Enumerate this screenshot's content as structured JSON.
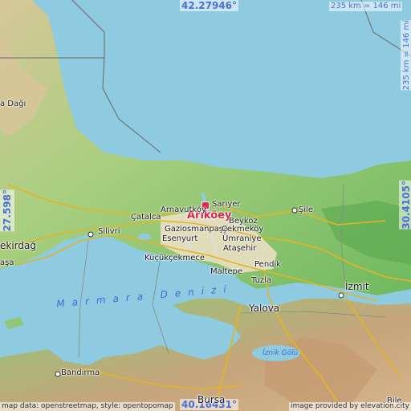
{
  "map": {
    "target": "Arıköey",
    "target_color": "#e0284f",
    "sea_color": "#8ecbe0",
    "land_colors": [
      "#7ec26b",
      "#b9d58a",
      "#d8c89b",
      "#c9a47a"
    ],
    "lat_top": "42.27946°",
    "lat_bottom": "40.16431°",
    "lon_left": "27.598°",
    "lon_right": "30.4105°",
    "scale_top": "235 km = 146 mi",
    "scale_right": "235 km = 146 mi",
    "sea_label": "Marmara Denizi",
    "lake_label": "İznik Gölü",
    "places": {
      "amavutkoy": "Arnavutköy",
      "sariyer": "Sarıyer",
      "beykoz": "Beykoz",
      "sile": "Şile",
      "catalca": "Çatalca",
      "gaziosmanpasa": "Gaziosmanpaşa",
      "cekmekoy": "Çekmeköy",
      "esenyurt": "Esenyurt",
      "umraniye": "Ümraniye",
      "silivri": "Silivri",
      "atasehir": "Ataşehir",
      "kucukcekmece": "Küçükçekmece",
      "tekirdag": "ekirdağ",
      "pasa": "aşa",
      "dagi": "a Dağı",
      "pendik": "Pendik",
      "tuzla": "Tuzla",
      "maltepe": "Maltepe",
      "izmit": "İzmit",
      "yalova": "Yalova",
      "bandirma": "Bandırma",
      "bursa": "Bursa",
      "bile": "Bile"
    },
    "credits": {
      "left": "map data: openstreetmap, style: opentopomap",
      "right": "image provided by elevation.city"
    }
  }
}
